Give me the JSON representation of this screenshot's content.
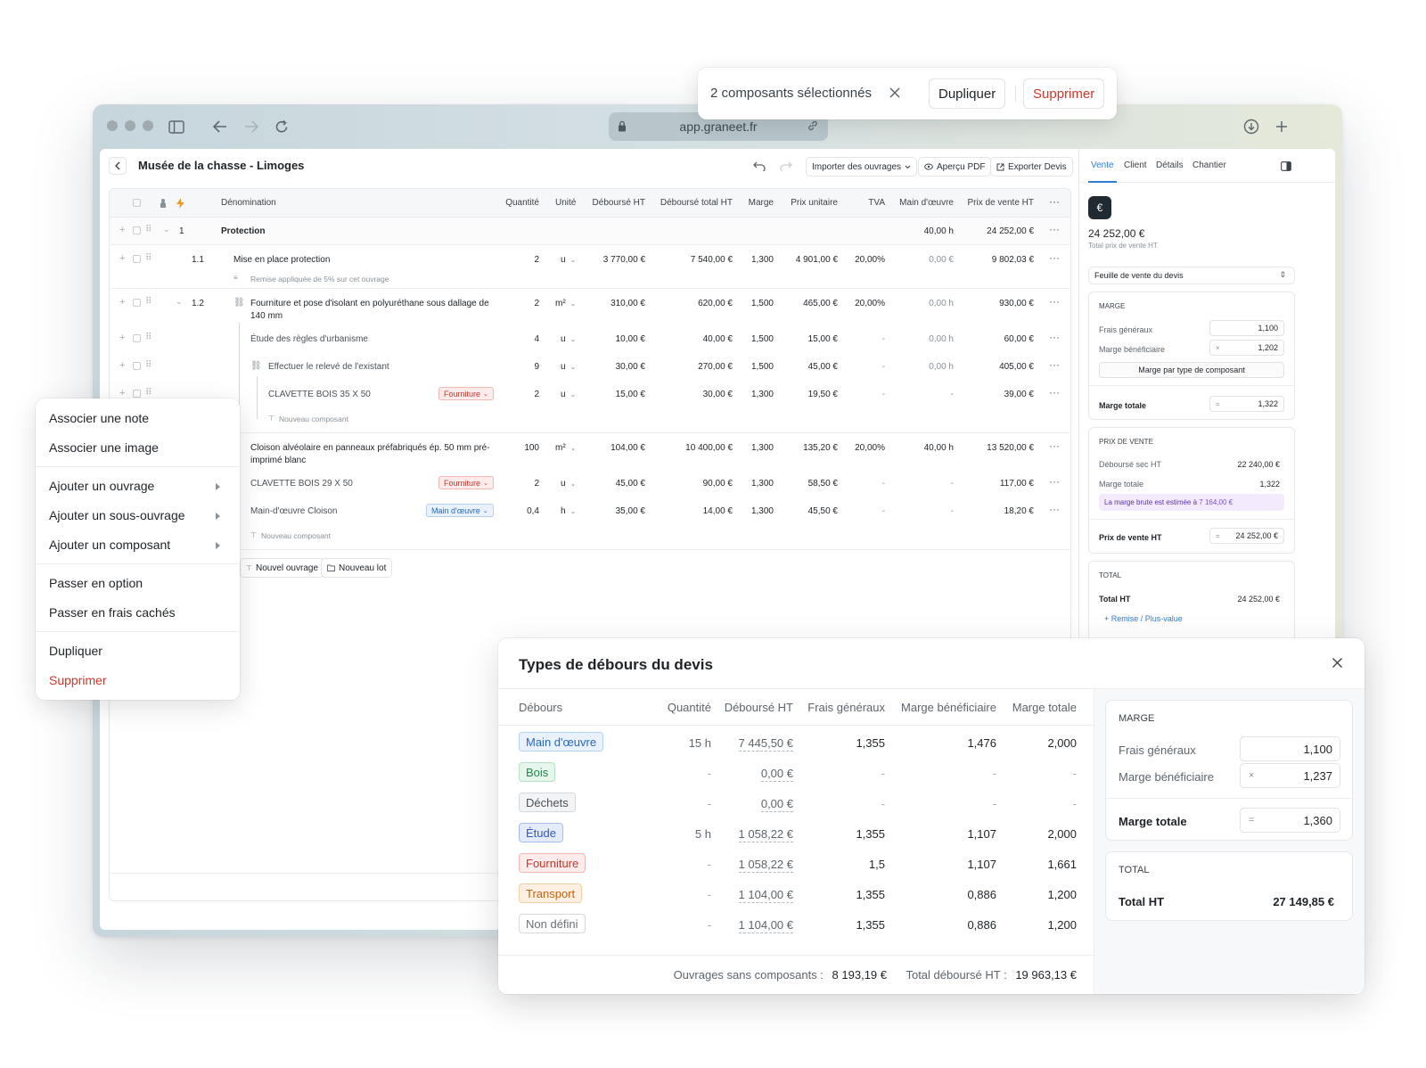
{
  "browser": {
    "url": "app.graneet.fr"
  },
  "toast": {
    "text": "2 composants sélectionnés",
    "duplicate": "Dupliquer",
    "delete": "Supprimer"
  },
  "header": {
    "title": "Musée de la chasse - Limoges",
    "import": "Importer des ouvrages",
    "preview": "Aperçu PDF",
    "export": "Exporter Devis"
  },
  "table": {
    "columns": {
      "name": "Dénomination",
      "qty": "Quantité",
      "unit": "Unité",
      "cost": "Déboursé HT",
      "total_cost": "Déboursé total HT",
      "margin": "Marge",
      "unit_price": "Prix unitaire",
      "vat": "TVA",
      "labor": "Main d'œuvre",
      "sale_price": "Prix de vente HT"
    },
    "lot1": {
      "num": "1",
      "name": "Protection",
      "labor": "40,00 h",
      "sale": "24 252,00 €"
    },
    "r11": {
      "num": "1.1",
      "name": "Mise en place protection",
      "qty": "2",
      "unit": "u",
      "cost": "3 770,00 €",
      "total": "7 540,00 €",
      "margin": "1,300",
      "pu": "4 901,00 €",
      "vat": "20,00%",
      "labor": "0,00 €",
      "sale": "9 802,03 €",
      "note": "Remise appliquée de 5% sur cet ouvrage"
    },
    "r12": {
      "num": "1.2",
      "name1": "Fourniture et pose d'isolant en polyuréthane sous dallage de",
      "name2": "140 mm",
      "qty": "2",
      "unit": "m²",
      "cost": "310,00 €",
      "total": "620,00 €",
      "margin": "1,500",
      "pu": "465,00 €",
      "vat": "20,00%",
      "labor": "0,00 h",
      "sale": "930,00 €"
    },
    "r12a": {
      "name": "Étude des règles d'urbanisme",
      "qty": "4",
      "unit": "u",
      "cost": "10,00 €",
      "total": "40,00 €",
      "margin": "1,500",
      "pu": "15,00 €",
      "vat": "-",
      "labor": "0,00 h",
      "sale": "60,00 €"
    },
    "r12b": {
      "name": "Effectuer le relevé de l'existant",
      "qty": "9",
      "unit": "u",
      "cost": "30,00 €",
      "total": "270,00 €",
      "margin": "1,500",
      "pu": "45,00 €",
      "vat": "-",
      "labor": "0,00 h",
      "sale": "405,00 €"
    },
    "r12c": {
      "name": "CLAVETTE BOIS 35 X 50",
      "tag": "Fourniture",
      "qty": "2",
      "unit": "u",
      "cost": "15,00 €",
      "total": "30,00 €",
      "margin": "1,300",
      "pu": "19,50 €",
      "vat": "-",
      "labor": "-",
      "sale": "39,00 €"
    },
    "new_component": "Nouveau composant",
    "r13": {
      "name1": "Cloison alvéolaire en panneaux préfabriqués ép. 50 mm pré-",
      "name2": "imprimé blanc",
      "qty": "100",
      "unit": "m²",
      "cost": "104,00 €",
      "total": "10 400,00 €",
      "margin": "1,300",
      "pu": "135,20 €",
      "vat": "20,00%",
      "labor": "40,00 h",
      "sale": "13 520,00 €"
    },
    "r13a": {
      "name": "CLAVETTE BOIS 29 X 50",
      "tag": "Fourniture",
      "qty": "2",
      "unit": "u",
      "cost": "45,00 €",
      "total": "90,00 €",
      "margin": "1,300",
      "pu": "58,50 €",
      "vat": "-",
      "labor": "-",
      "sale": "117,00 €"
    },
    "r13b": {
      "name": "Main-d'œuvre Cloison",
      "tag": "Main d'œuvre",
      "qty": "0,4",
      "unit": "h",
      "cost": "35,00 €",
      "total": "14,00 €",
      "margin": "1,300",
      "pu": "45,50 €",
      "vat": "-",
      "labor": "-",
      "sale": "18,20 €"
    },
    "new_work": "Nouvel ouvrage",
    "new_lot": "Nouveau lot"
  },
  "panel": {
    "tabs": [
      "Vente",
      "Client",
      "Détails",
      "Chantier"
    ],
    "total_amount": "24 252,00 €",
    "total_caption": "Total prix de vente HT",
    "sheet_select": "Feuille de vente du devis",
    "marge_title": "MARGE",
    "frais_label": "Frais généraux",
    "frais_value": "1,100",
    "benef_label": "Marge bénéficiaire",
    "benef_value": "1,202",
    "by_type_btn": "Marge par type de composant",
    "total_marge_label": "Marge totale",
    "total_marge_value": "1,322",
    "pv_title": "PRIX DE VENTE",
    "debourse_label": "Déboursé sec HT",
    "debourse_value": "22 240,00 €",
    "pv_marge_label": "Marge totale",
    "pv_marge_value": "1,322",
    "brute_text": "La marge brute est estimée à",
    "brute_value": "7 164,00 €",
    "pv_ht_label": "Prix de vente HT",
    "pv_ht_value": "24 252,00 €",
    "total_title": "TOTAL",
    "total_ht_label": "Total HT",
    "total_ht_value": "24 252,00 €",
    "remise_link": "+ Remise / Plus-value"
  },
  "context_menu": {
    "items": [
      "Associer une note",
      "Associer une image",
      "Ajouter un ouvrage",
      "Ajouter un sous-ouvrage",
      "Ajouter un composant",
      "Passer en option",
      "Passer en frais cachés",
      "Dupliquer",
      "Supprimer"
    ]
  },
  "modal": {
    "title": "Types de débours du devis",
    "columns": [
      "Débours",
      "Quantité",
      "Déboursé HT",
      "Frais généraux",
      "Marge bénéficiaire",
      "Marge totale"
    ],
    "rows": [
      {
        "type": "Main d'œuvre",
        "color": "#2668c5",
        "qty": "15 h",
        "cost": "7 445,50 €",
        "fg": "1,355",
        "mb": "1,476",
        "mt": "2,000"
      },
      {
        "type": "Bois",
        "color": "#1f8a4c",
        "qty": "-",
        "cost": "0,00 €",
        "fg": "-",
        "mb": "-",
        "mt": "-"
      },
      {
        "type": "Déchets",
        "color": "#4a5157",
        "qty": "-",
        "cost": "0,00 €",
        "fg": "-",
        "mb": "-",
        "mt": "-"
      },
      {
        "type": "Étude",
        "color": "#3558b5",
        "qty": "5 h",
        "cost": "1 058,22 €",
        "fg": "1,355",
        "mb": "1,107",
        "mt": "2,000"
      },
      {
        "type": "Fourniture",
        "color": "#c8352b",
        "qty": "-",
        "cost": "1 058,22 €",
        "fg": "1,5",
        "mb": "1,107",
        "mt": "1,661"
      },
      {
        "type": "Transport",
        "color": "#c2620f",
        "qty": "-",
        "cost": "1 104,00 €",
        "fg": "1,355",
        "mb": "0,886",
        "mt": "1,200"
      },
      {
        "type": "Non défini",
        "color": "#6b7278",
        "qty": "-",
        "cost": "1 104,00 €",
        "fg": "1,355",
        "mb": "0,886",
        "mt": "1,200"
      }
    ],
    "footer_sans_label": "Ouvrages sans composants :",
    "footer_sans_value": "8 193,19 €",
    "footer_total_label": "Total déboursé HT :",
    "footer_total_value": "19 963,13 €",
    "marge_title": "MARGE",
    "frais_label": "Frais généraux",
    "frais_value": "1,100",
    "benef_label": "Marge bénéficiaire",
    "benef_value": "1,237",
    "total_marge_label": "Marge totale",
    "total_marge_value": "1,360",
    "total_title": "TOTAL",
    "total_ht_label": "Total HT",
    "total_ht_value": "27 149,85 €"
  }
}
